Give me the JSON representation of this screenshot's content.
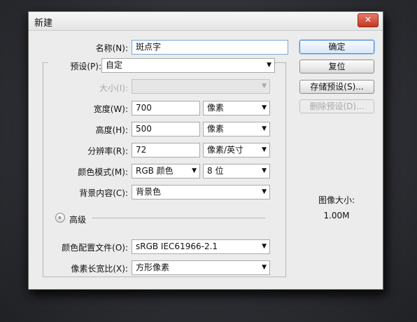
{
  "dialog": {
    "title": "新建",
    "close_label": "✕"
  },
  "form": {
    "name_label": "名称(N):",
    "name_value": "斑点字",
    "preset_label": "预设(P):",
    "preset_value": "自定",
    "size_label": "大小(I):",
    "size_value": "",
    "width_label": "宽度(W):",
    "width_value": "700",
    "width_unit": "像素",
    "height_label": "高度(H):",
    "height_value": "500",
    "height_unit": "像素",
    "resolution_label": "分辨率(R):",
    "resolution_value": "72",
    "resolution_unit": "像素/英寸",
    "color_mode_label": "颜色模式(M):",
    "color_mode_value": "RGB 颜色",
    "bit_depth_value": "8 位",
    "background_label": "背景内容(C):",
    "background_value": "背景色",
    "advanced_label": "高级",
    "color_profile_label": "颜色配置文件(O):",
    "color_profile_value": "sRGB IEC61966-2.1",
    "pixel_aspect_label": "像素长宽比(X):",
    "pixel_aspect_value": "方形像素"
  },
  "buttons": {
    "ok": "确定",
    "reset": "复位",
    "save_preset": "存储预设(S)...",
    "delete_preset": "删除预设(D)..."
  },
  "info": {
    "image_size_label": "图像大小:",
    "image_size_value": "1.00M"
  },
  "icons": {
    "dropdown": "▼",
    "advanced_toggle": "»"
  }
}
